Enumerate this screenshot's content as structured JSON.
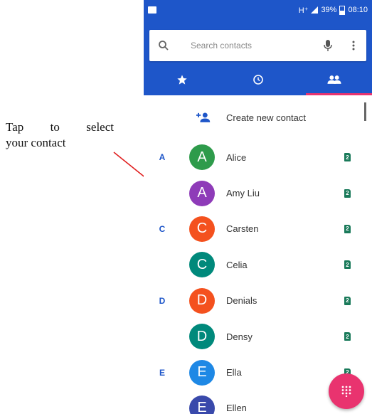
{
  "annotation": {
    "line1_words": [
      "Tap",
      "to",
      "select"
    ],
    "line2": "your contact",
    "arrow_color": "#e02020"
  },
  "status_bar": {
    "network": "H⁺",
    "signal_icon": "signal-icon",
    "battery_percent": "39%",
    "battery_icon": "battery-icon",
    "time": "08:10"
  },
  "search": {
    "placeholder": "Search contacts",
    "search_icon": "search-icon",
    "mic_icon": "mic-icon",
    "more_icon": "more-vert-icon"
  },
  "tabs": [
    {
      "name": "favorites",
      "icon": "star-icon",
      "active": false
    },
    {
      "name": "recents",
      "icon": "clock-icon",
      "active": false
    },
    {
      "name": "contacts",
      "icon": "people-icon",
      "active": true
    }
  ],
  "create_contact": {
    "label": "Create new contact",
    "icon": "add-person-icon"
  },
  "contacts": [
    {
      "letter": "A",
      "initial": "A",
      "name": "Alice",
      "color": "#2e9b4b"
    },
    {
      "letter": "",
      "initial": "A",
      "name": "Amy Liu",
      "color": "#8e3bb8"
    },
    {
      "letter": "C",
      "initial": "C",
      "name": "Carsten",
      "color": "#f4511e"
    },
    {
      "letter": "",
      "initial": "C",
      "name": "Celia",
      "color": "#00897b"
    },
    {
      "letter": "D",
      "initial": "D",
      "name": "Denials",
      "color": "#f4511e"
    },
    {
      "letter": "",
      "initial": "D",
      "name": "Densy",
      "color": "#00897b"
    },
    {
      "letter": "E",
      "initial": "E",
      "name": "Ella",
      "color": "#1e88e5"
    },
    {
      "letter": "",
      "initial": "E",
      "name": "Ellen",
      "color": "#3949ab"
    }
  ],
  "sim_label": "2",
  "fab_icon": "dialpad-icon",
  "colors": {
    "primary": "#1e56c9",
    "accent": "#e9336f",
    "sim": "#1a7a5a"
  }
}
